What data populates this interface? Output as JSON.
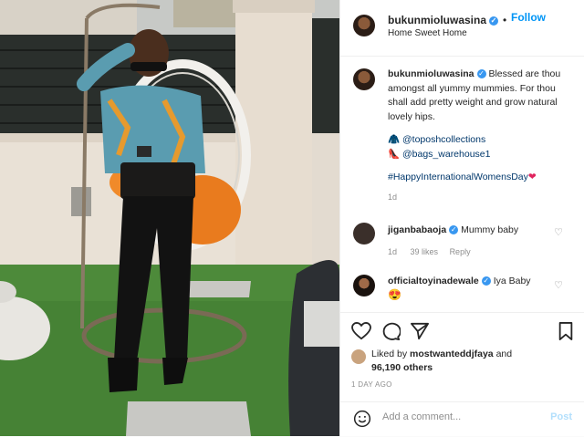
{
  "header": {
    "username": "bukunmioluwasina",
    "follow_label": "Follow",
    "location": "Home Sweet Home"
  },
  "caption": {
    "username": "bukunmioluwasina",
    "text": "Blessed are thou amongst all yummy mummies. For thou shall add pretty weight and grow natural lovely hips.",
    "mention1": "@toposhcollections",
    "mention2": "@bags_warehouse1",
    "hashtag": "#HappyInternationalWomensDay",
    "age": "1d"
  },
  "comments": [
    {
      "username": "jiganbabaoja",
      "text": "Mummy baby",
      "age": "1d",
      "likes": "39 likes",
      "reply": "Reply"
    },
    {
      "username": "officialtoyinadewale",
      "text": "Iya Baby"
    }
  ],
  "likes": {
    "prefix": "Liked by",
    "user": "mostwanteddjfaya",
    "and": "and",
    "others": "96,190 others"
  },
  "date": "1 DAY AGO",
  "add_comment": {
    "placeholder": "Add a comment...",
    "post_label": "Post"
  },
  "colors": {
    "link": "#00376b",
    "accent": "#0095f6",
    "verified": "#3897f0"
  },
  "icons": [
    "verified-badge-icon",
    "heart-icon",
    "comment-icon",
    "share-icon",
    "bookmark-icon",
    "emoji-icon",
    "coat-icon",
    "shoe-icon",
    "heart-emoji-icon",
    "heart-eyes-emoji-icon"
  ]
}
